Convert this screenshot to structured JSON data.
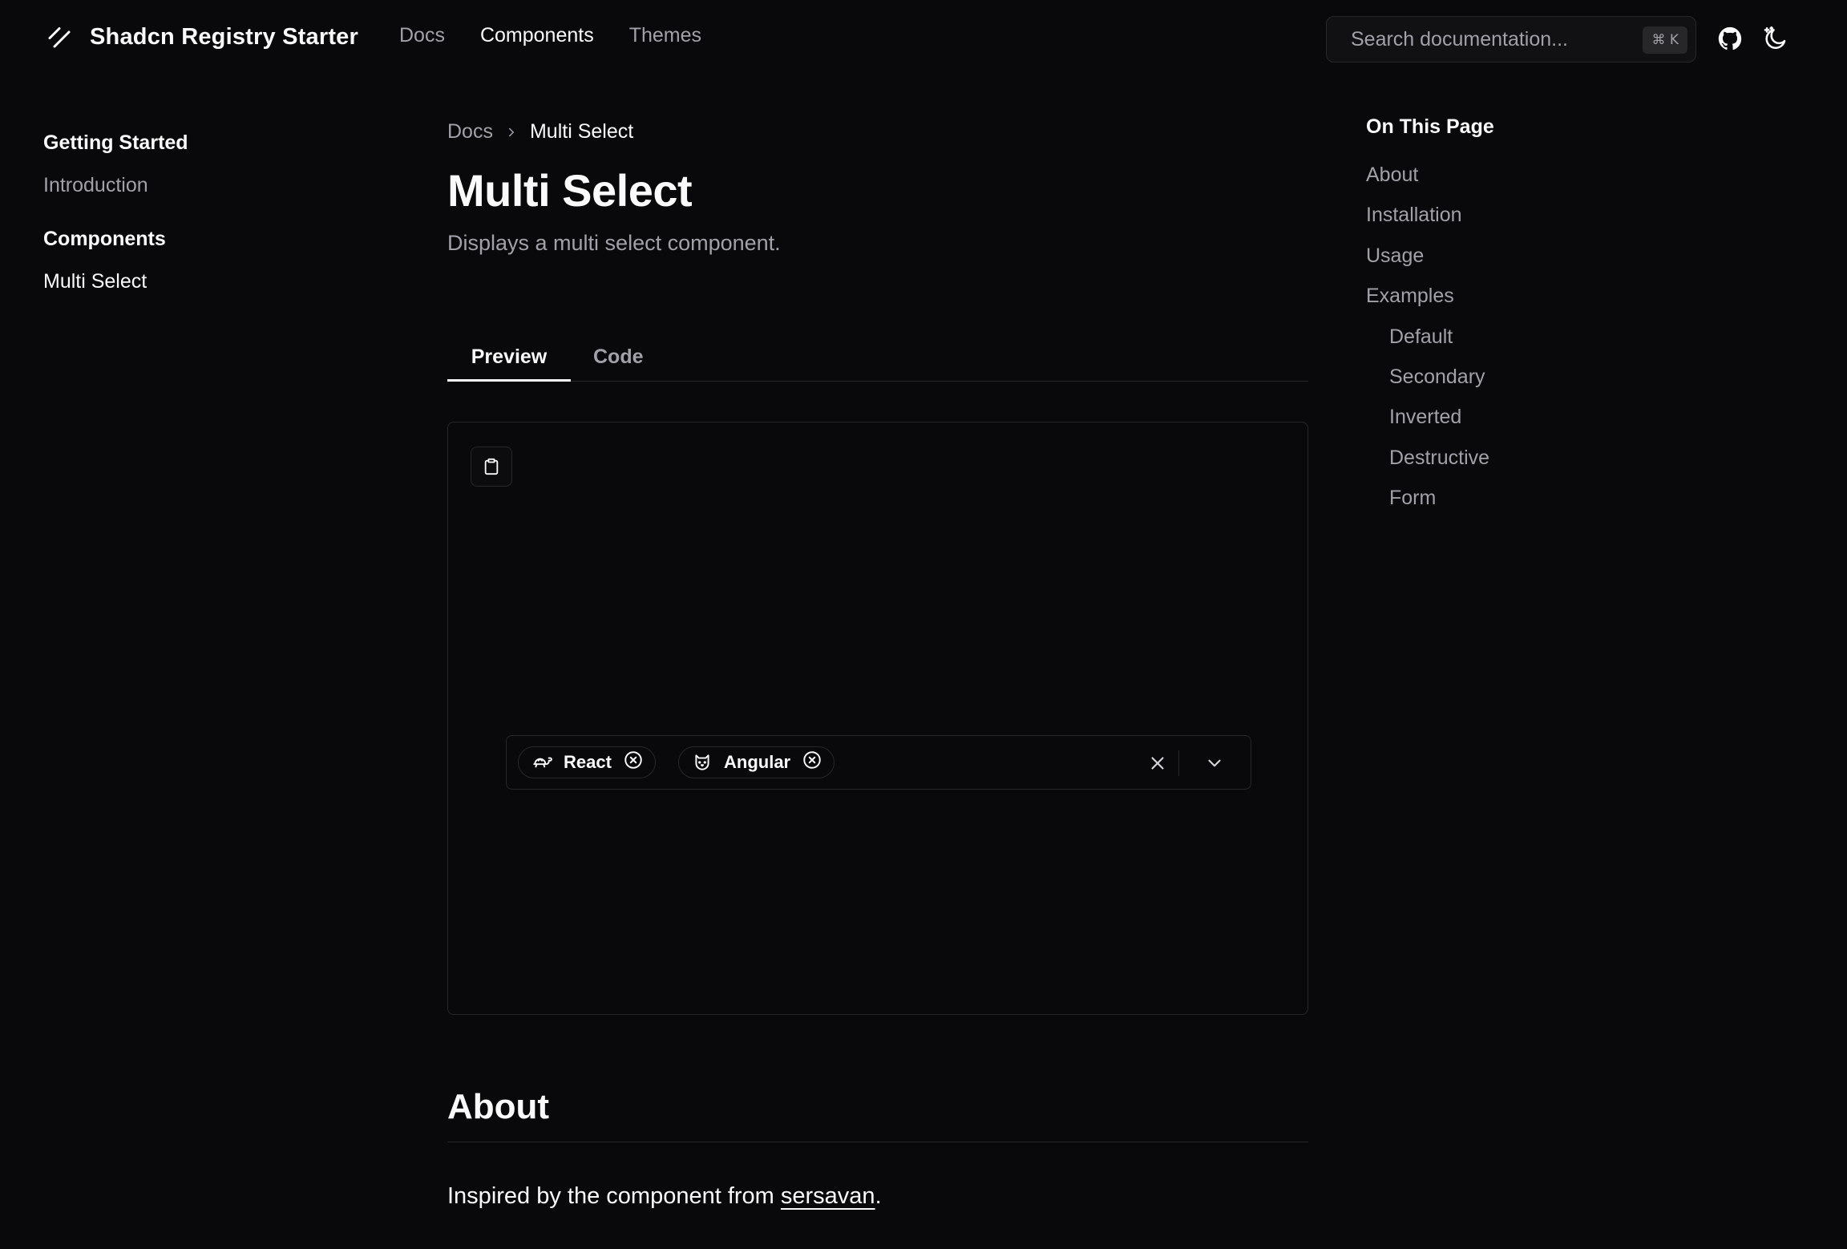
{
  "header": {
    "brand": "Shadcn Registry Starter",
    "nav": [
      {
        "label": "Docs",
        "active": false
      },
      {
        "label": "Components",
        "active": true
      },
      {
        "label": "Themes",
        "active": false
      }
    ],
    "search_placeholder": "Search documentation...",
    "search_shortcut": "⌘ K",
    "icons": [
      "logo-slash-icon",
      "github-icon",
      "theme-toggle-icon"
    ]
  },
  "sidebar": {
    "groups": [
      {
        "heading": "Getting Started",
        "items": [
          {
            "label": "Introduction",
            "active": false
          }
        ]
      },
      {
        "heading": "Components",
        "items": [
          {
            "label": "Multi Select",
            "active": true
          }
        ]
      }
    ]
  },
  "main": {
    "breadcrumb": [
      "Docs",
      "Multi Select"
    ],
    "title": "Multi Select",
    "subtitle": "Displays a multi select component.",
    "tabs": [
      {
        "label": "Preview",
        "active": true
      },
      {
        "label": "Code",
        "active": false
      }
    ],
    "multi_select": {
      "selected": [
        {
          "label": "React",
          "icon": "turtle-icon"
        },
        {
          "label": "Angular",
          "icon": "cat-icon"
        }
      ]
    },
    "about": {
      "heading": "About",
      "text_before": "Inspired by the component from ",
      "link": "sersavan",
      "text_after": "."
    }
  },
  "toc": {
    "title": "On This Page",
    "items": [
      {
        "label": "About",
        "level": 1
      },
      {
        "label": "Installation",
        "level": 1
      },
      {
        "label": "Usage",
        "level": 1
      },
      {
        "label": "Examples",
        "level": 1
      },
      {
        "label": "Default",
        "level": 2
      },
      {
        "label": "Secondary",
        "level": 2
      },
      {
        "label": "Inverted",
        "level": 2
      },
      {
        "label": "Destructive",
        "level": 2
      },
      {
        "label": "Form",
        "level": 2
      }
    ]
  },
  "colors": {
    "background": "#09090b",
    "foreground": "#fafafa",
    "muted": "#a1a1aa",
    "border": "#27272a"
  }
}
